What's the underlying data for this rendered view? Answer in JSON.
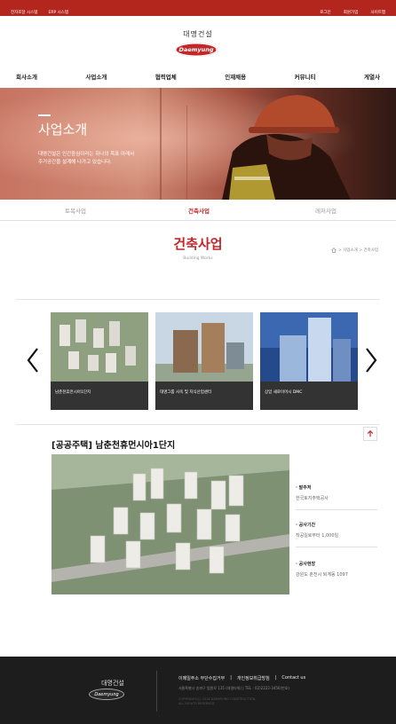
{
  "topbar": {
    "left_links": [
      "전자조달 시스템",
      "ERP 시스템"
    ],
    "right_links": [
      "로그인",
      "회원가입",
      "사이트맵"
    ]
  },
  "header": {
    "brand_name": "대명건설",
    "logo_text": "Daemyung"
  },
  "gnb": [
    "회사소개",
    "사업소개",
    "협력업체",
    "인재채용",
    "커뮤니티",
    "게열사"
  ],
  "hero": {
    "title": "사업소개",
    "desc_line1": "대명건설은 인간중심이라는 하나의 목표 아래서",
    "desc_line2": "주거공간을 설계해 나가고 있습니다."
  },
  "subtabs": [
    "토목사업",
    "건축사업",
    "레저사업"
  ],
  "page_title": "건축사업",
  "page_subtitle": "Building Works",
  "breadcrumb": "> 사업소개 > 건축사업",
  "carousel": {
    "items": [
      {
        "caption": "남춘천휴먼시아1단지"
      },
      {
        "caption": "대명그룹 사옥 및 지식산업센터"
      },
      {
        "caption": "상암 새로이어시 DMC"
      }
    ]
  },
  "project": {
    "title": "[공공주택] 남춘천휴먼시아1단지",
    "fields": [
      {
        "label": "· 발주처",
        "value": "한국토지주택공사"
      },
      {
        "label": "· 공사기간",
        "value": "착공일로부터 1,000일"
      },
      {
        "label": "· 공사현장",
        "value": "강원도 춘천시 퇴계동 1097"
      }
    ]
  },
  "footer": {
    "brand_name": "대명건설",
    "logo_text": "Daemyung",
    "links": [
      "이메일주소 무단수집거부",
      "|",
      "개인정보취급방침",
      "|",
      "Contact us"
    ],
    "address": "서울특별시 송파구 법원로 135 (대명타워) | TEL : 02)2222-3456(번호)",
    "copyright_line1": "COPYRIGHT(C) 2018 DAEMYUNG CONSTRUCTION.",
    "copyright_line2": "ALL RIGHTS RESERVED"
  },
  "colors": {
    "accent": "#c0282a",
    "footer_bg": "#1d1d1d"
  }
}
